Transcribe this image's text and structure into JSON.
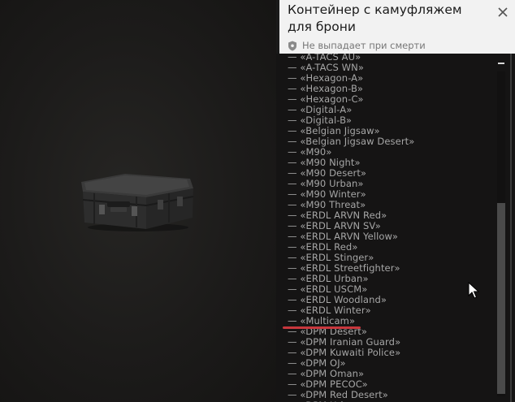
{
  "header": {
    "title": "Контейнер с камуфляжем для брони",
    "subtitle": "Не выпадает при смерти",
    "shield_icon": "shield-icon",
    "close_icon": "close-icon"
  },
  "list_items": [
    "— «A-TACS AU»",
    "— «A-TACS WN»",
    "— «Hexagon-A»",
    "— «Hexagon-B»",
    "— «Hexagon-C»",
    "— «Digital-A»",
    "— «Digital-B»",
    "— «Belgian Jigsaw»",
    "— «Belgian Jigsaw Desert»",
    "— «M90»",
    "— «M90 Night»",
    "— «M90 Desert»",
    "— «M90 Urban»",
    "— «M90 Winter»",
    "— «M90 Threat»",
    "— «ERDL ARVN Red»",
    "— «ERDL ARVN SV»",
    "— «ERDL ARVN Yellow»",
    "— «ERDL Red»",
    "— «ERDL Stinger»",
    "— «ERDL Streetfighter»",
    "— «ERDL Urban»",
    "— «ERDL USCM»",
    "— «ERDL Woodland»",
    "— «ERDL Winter»",
    "— «Multicam»",
    "— «DPM Desert»",
    "— «DPM Iranian Guard»",
    "— «DPM Kuwaiti Police»",
    "— «DPM OJ»",
    "— «DPM Oman»",
    "— «DPM PECOC»",
    "— «DPM Red Desert»",
    "— «DPM Urban»"
  ],
  "highlighted_item_index": 25,
  "colors": {
    "header_bg": "#f2f2f2",
    "panel_bg": "#151414",
    "list_text": "#a6a6a6",
    "highlight_underline": "#c8373d",
    "scroll_thumb": "#4a4a4a"
  }
}
